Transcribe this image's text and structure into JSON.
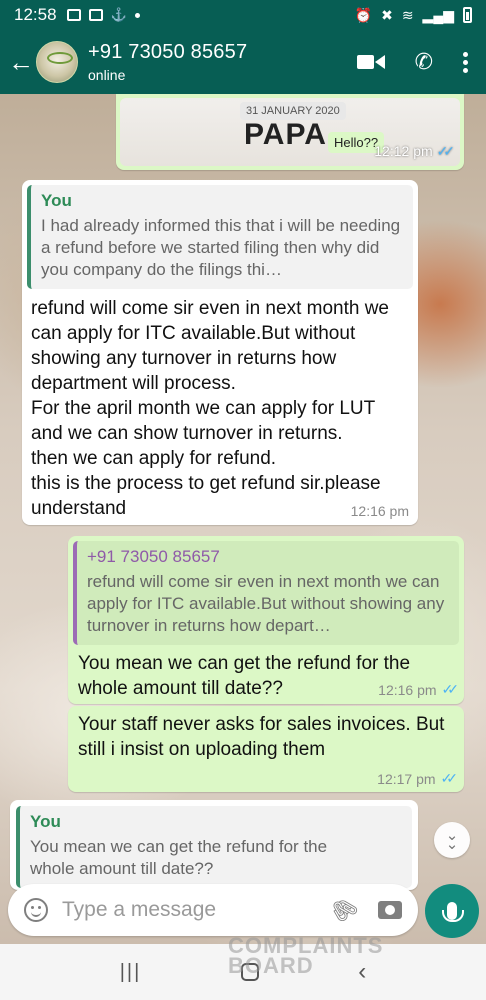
{
  "status_bar": {
    "time": "12:58"
  },
  "header": {
    "contact_name": "+91 73050 85657",
    "status": "online"
  },
  "media_message": {
    "date_chip": "31 JANUARY 2020",
    "image_text": "PAPA",
    "inner_chip": "Hello??",
    "time": "12:12 pm"
  },
  "messages": [
    {
      "direction": "incoming",
      "quote_name": "You",
      "quote_text": "I had already informed this that i will be needing a refund before we started filing then why did you company do the filings thi…",
      "text": "refund will come sir even in next month we can apply for ITC available.But without showing any turnover in returns how department will process.\nFor the april month we can apply for LUT and we can show turnover in returns.\nthen we can apply for refund.\nthis is the process to get refund sir.please understand",
      "time": "12:16 pm"
    },
    {
      "direction": "outgoing",
      "quote_name": "+91 73050 85657",
      "quote_text": "refund will come sir even in next month we can apply for ITC available.But without showing any turnover in returns how depart…",
      "text": "You mean we can get the refund for the whole amount till date??",
      "time": "12:16 pm"
    },
    {
      "direction": "outgoing",
      "text": "Your staff never asks for sales invoices. But still i insist on uploading them",
      "time": "12:17 pm"
    },
    {
      "direction": "incoming",
      "quote_name": "You",
      "quote_text": "You mean we can get the refund for the whole amount till date??"
    }
  ],
  "input": {
    "placeholder": "Type a message"
  },
  "watermark": {
    "line1": "COMPLAINTS",
    "line2": "BOARD"
  },
  "icons": {
    "back": "back-arrow-icon",
    "video": "video-call-icon",
    "phone": "phone-icon",
    "menu": "more-options-icon",
    "emoji": "emoji-icon",
    "attach": "attachment-icon",
    "camera": "camera-icon",
    "mic": "microphone-icon"
  },
  "colors": {
    "header": "#075e54",
    "outgoing_bubble": "#dcf8c6",
    "incoming_bubble": "#ffffff",
    "read_ticks": "#4fb3f4",
    "mic_button": "#128c7e"
  }
}
